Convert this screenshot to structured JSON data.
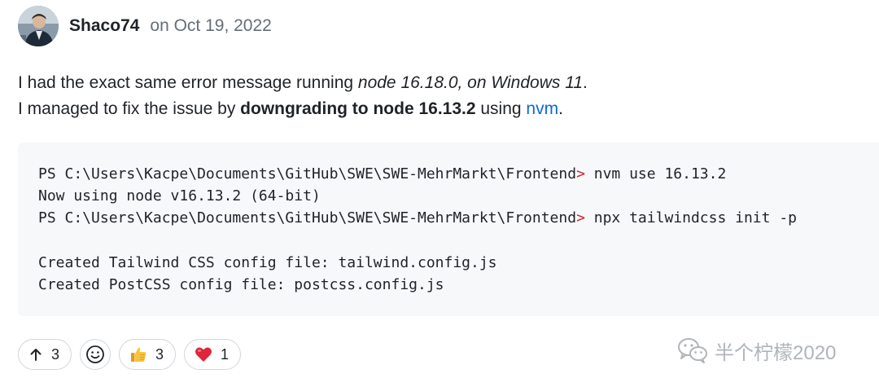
{
  "comment": {
    "author": "Shaco74",
    "date": "on Oct 19, 2022",
    "line1": {
      "prefix": "I had the exact same error message running ",
      "emphasis": "node 16.18.0, on Windows 11",
      "suffix": "."
    },
    "line2": {
      "prefix": "I managed to fix the issue by ",
      "strong": "downgrading to node 16.13.2",
      "middle": " using ",
      "link": "nvm",
      "suffix": "."
    }
  },
  "code": {
    "lines": [
      {
        "before": "PS C:\\Users\\Kacpe\\Documents\\GitHub\\SWE\\SWE-MehrMarkt\\Frontend",
        "prompt": ">",
        "after": " nvm use 16.13.2"
      },
      {
        "before": "Now using node v16.13.2 (64-bit)",
        "prompt": "",
        "after": ""
      },
      {
        "before": "PS C:\\Users\\Kacpe\\Documents\\GitHub\\SWE\\SWE-MehrMarkt\\Frontend",
        "prompt": ">",
        "after": " npx tailwindcss init -p"
      },
      {
        "before": "",
        "prompt": "",
        "after": ""
      },
      {
        "before": "Created Tailwind CSS config file: tailwind.config.js",
        "prompt": "",
        "after": ""
      },
      {
        "before": "Created PostCSS config file: postcss.config.js",
        "prompt": "",
        "after": ""
      }
    ]
  },
  "reactions": {
    "upvote": {
      "icon": "arrow-up-icon",
      "count": "3"
    },
    "add_reaction": {
      "icon": "smiley-icon"
    },
    "thumbs_up": {
      "icon": "thumbs-up-emoji",
      "count": "3"
    },
    "heart": {
      "icon": "heart-emoji",
      "count": "1"
    }
  },
  "watermark": {
    "text": "半个柠檬2020",
    "icon": "wechat-icon"
  },
  "colors": {
    "link": "#0969da",
    "prompt": "#cf222e",
    "code_bg": "#f6f8fa",
    "muted": "#656d76",
    "border": "#d0d7de"
  }
}
